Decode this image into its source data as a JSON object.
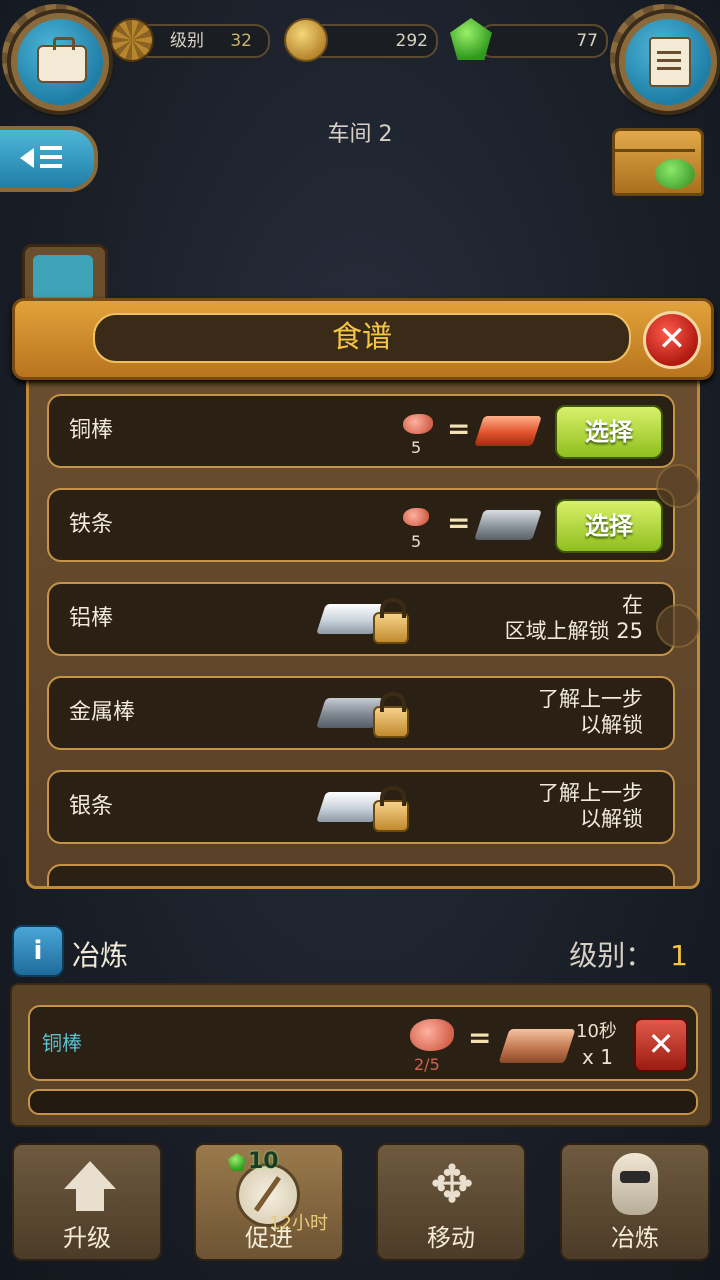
{
  "top_bar": {
    "level_label": "级别",
    "level_value": "32",
    "coins_value": "292",
    "gems_value": "77"
  },
  "workshop_title": "车间 2",
  "recipe_dialog": {
    "title": "食谱",
    "recipes": [
      {
        "name": "铜棒",
        "ore_qty": "5",
        "select_label": "选择"
      },
      {
        "name": "铁条",
        "ore_qty": "5",
        "select_label": "选择"
      },
      {
        "name": "铝棒",
        "unlock_line1": "在",
        "unlock_line2": "区域上解锁 25"
      },
      {
        "name": "金属棒",
        "unlock_line1": "了解上一步",
        "unlock_line2": "以解锁"
      },
      {
        "name": "银条",
        "unlock_line1": "了解上一步",
        "unlock_line2": "以解锁"
      }
    ]
  },
  "smelter": {
    "name": "冶炼",
    "level_label": "级别：",
    "level_value": "1",
    "queue": {
      "item_name": "铜棒",
      "ore_progress": "2/5",
      "time": "10秒",
      "multiplier": "x 1"
    }
  },
  "actions": {
    "upgrade": "升级",
    "boost": "促进",
    "boost_cost": "10",
    "boost_time": "12小时",
    "move": "移动",
    "smelt": "冶炼"
  },
  "colors": {
    "accent_orange": "#e2a23a",
    "select_green": "#8fbf1e",
    "title_gold": "#f5c542",
    "close_red": "#b01a12"
  }
}
